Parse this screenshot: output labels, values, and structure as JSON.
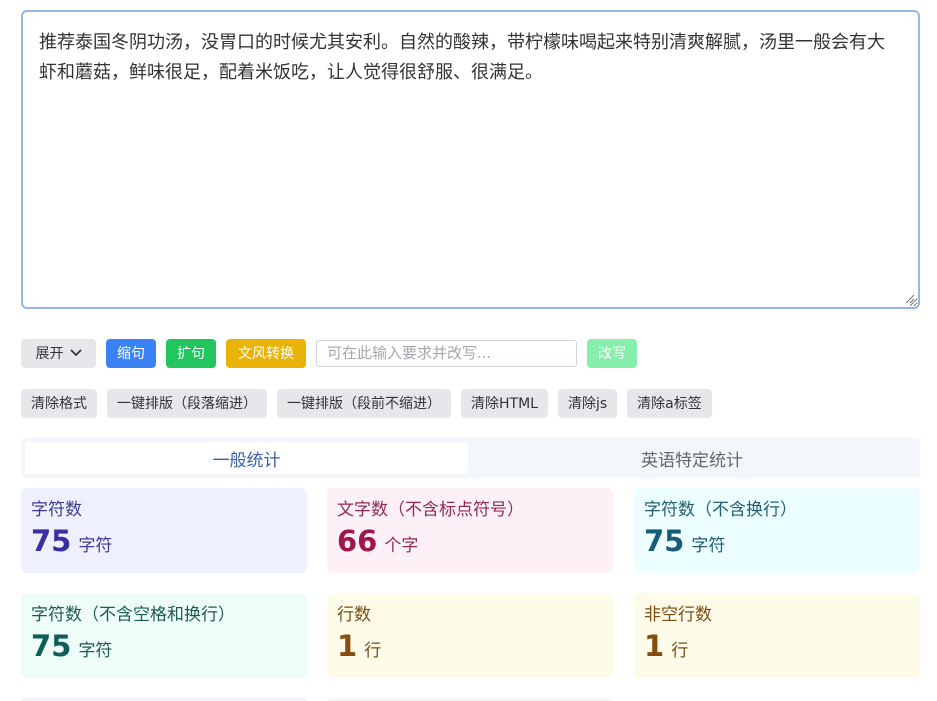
{
  "editor": {
    "text": "推荐泰国冬阴功汤，没胃口的时候尤其安利。自然的酸辣，带柠檬味喝起来特别清爽解腻，汤里一般会有大虾和蘑菇，鲜味很足，配着米饭吃，让人觉得很舒服、很满足。"
  },
  "toolbar": {
    "expand_label": "展开",
    "shorten_label": "缩句",
    "expand_sentence_label": "扩句",
    "style_convert_label": "文风转换",
    "rewrite_placeholder": "可在此输入要求并改写...",
    "rewrite_value": "",
    "rewrite_label": "改写"
  },
  "format_toolbar": {
    "clear_format": "清除格式",
    "layout_indent": "一键排版（段落缩进）",
    "layout_no_indent": "一键排版（段前不缩进）",
    "clear_html": "清除HTML",
    "clear_js": "清除js",
    "clear_a": "清除a标签"
  },
  "tabs": {
    "general": "一般统计",
    "english": "英语特定统计"
  },
  "stats": [
    {
      "label": "字符数",
      "value": "75",
      "unit": "字符"
    },
    {
      "label": "文字数（不含标点符号）",
      "value": "66",
      "unit": "个字"
    },
    {
      "label": "字符数（不含换行）",
      "value": "75",
      "unit": "字符"
    },
    {
      "label": "字符数（不含空格和换行）",
      "value": "75",
      "unit": "字符"
    },
    {
      "label": "行数",
      "value": "1",
      "unit": "行"
    },
    {
      "label": "非空行数",
      "value": "1",
      "unit": "行"
    }
  ],
  "colors": {
    "editor_border": "#93b5e8",
    "shorten_button": "#3b82f6",
    "expand_button": "#22c55e",
    "style_button": "#eab308",
    "rewrite_button": "#86efac",
    "active_tab_text": "#3b5ea8"
  }
}
